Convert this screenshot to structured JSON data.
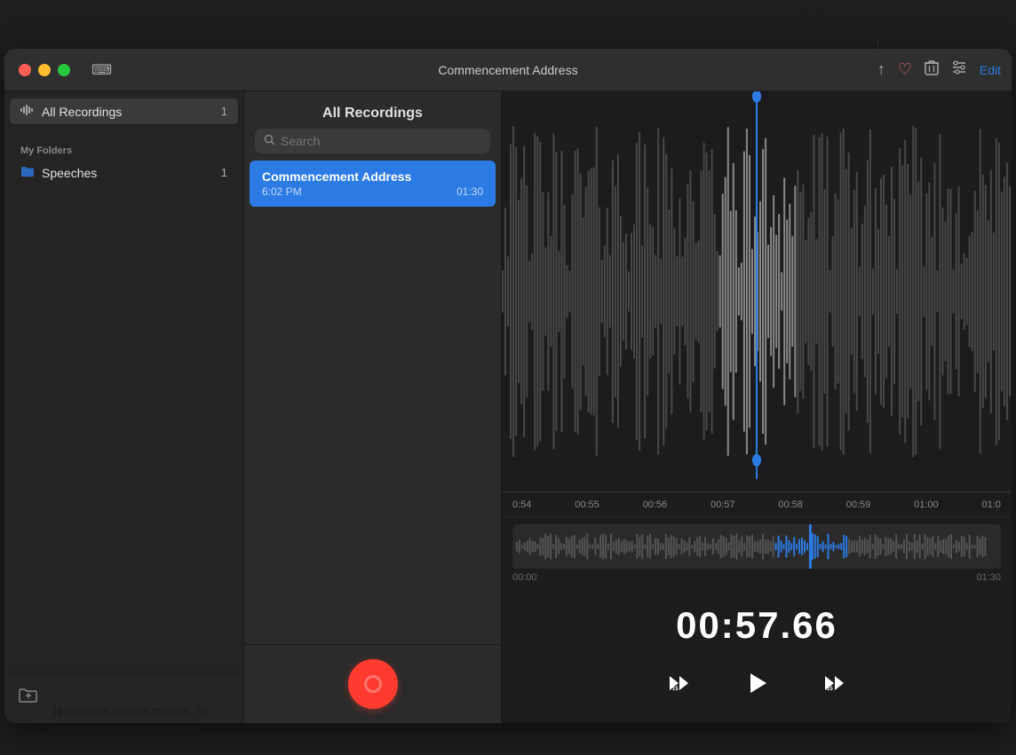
{
  "annotations": {
    "top_tooltip": "Atzīmējiet ierakstus kā Favorites.",
    "bottom_tooltip_line1": "Izveidojiet jaunas mapes, lai",
    "bottom_tooltip_line2": "organizētu savus ierakstus."
  },
  "window": {
    "title": "Commencement Address",
    "traffic_lights": {
      "close": "close",
      "minimize": "minimize",
      "maximize": "maximize"
    },
    "sidebar_toggle_icon": "⊞",
    "toolbar": {
      "share_icon": "↑",
      "favorite_icon": "♡",
      "delete_icon": "🗑",
      "options_icon": "☰",
      "edit_label": "Edit"
    }
  },
  "left_sidebar": {
    "all_recordings_label": "All Recordings",
    "all_recordings_count": "1",
    "my_folders_header": "My Folders",
    "folders": [
      {
        "name": "Speeches",
        "count": "1",
        "icon": "folder"
      }
    ],
    "new_folder_icon": "📁"
  },
  "middle_panel": {
    "header": "All Recordings",
    "search": {
      "placeholder": "Search",
      "icon": "search"
    },
    "recordings": [
      {
        "title": "Commencement Address",
        "time": "6:02 PM",
        "duration": "01:30",
        "selected": true
      }
    ],
    "record_button_label": "Record"
  },
  "right_panel": {
    "timeline": {
      "labels": [
        "0:54",
        "00:55",
        "00:56",
        "00:57",
        "00:58",
        "00:59",
        "01:00",
        "01:0"
      ]
    },
    "overview": {
      "start_time": "00:00",
      "end_time": "01:30"
    },
    "timer": "00:57.66",
    "controls": {
      "rewind_label": "15",
      "play_icon": "▶",
      "forward_label": "15"
    }
  }
}
